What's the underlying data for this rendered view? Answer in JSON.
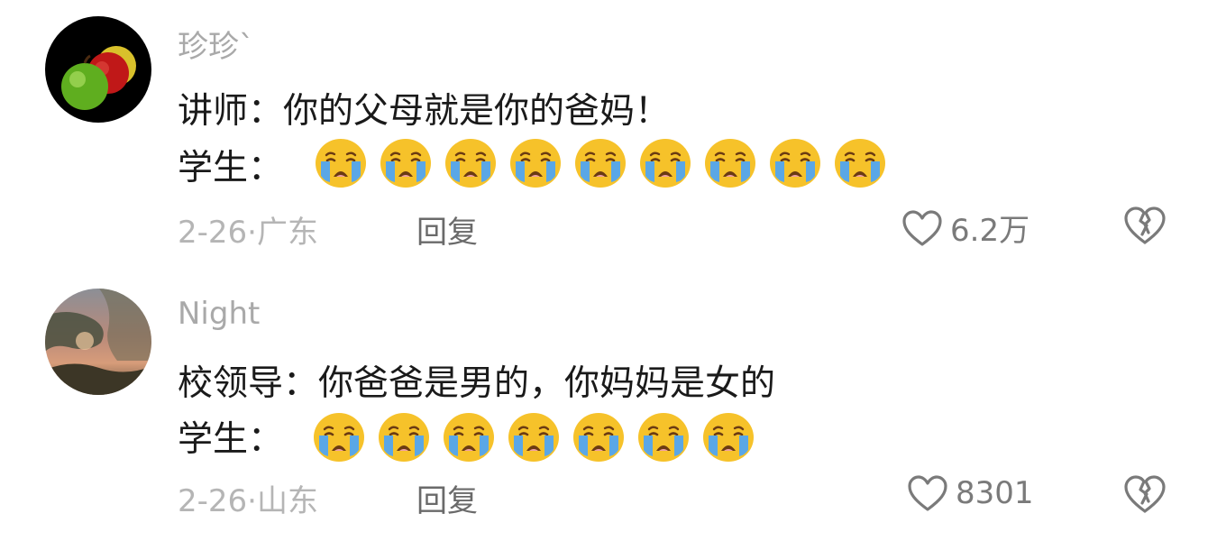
{
  "comments": [
    {
      "username": "珍珍`",
      "lines": [
        {
          "text": "讲师：你的父母就是你的爸妈！"
        },
        {
          "text": "学生："
        }
      ],
      "emoji_name": "loudly-crying-face-icon",
      "emoji_count": 9,
      "date_location": "2-26·广东",
      "reply_label": "回复",
      "like_count": "6.2万"
    },
    {
      "username": "Night",
      "lines": [
        {
          "text": "校领导：你爸爸是男的，你妈妈是女的"
        },
        {
          "text": "学生："
        }
      ],
      "emoji_name": "loudly-crying-face-icon",
      "emoji_count": 7,
      "date_location": "2-26·山东",
      "reply_label": "回复",
      "like_count": "8301"
    }
  ],
  "colors": {
    "username": "#a9a9a9",
    "meta": "#b5b5b5",
    "reply": "#6a6a6a",
    "icon_stroke": "#7a7a7a"
  }
}
